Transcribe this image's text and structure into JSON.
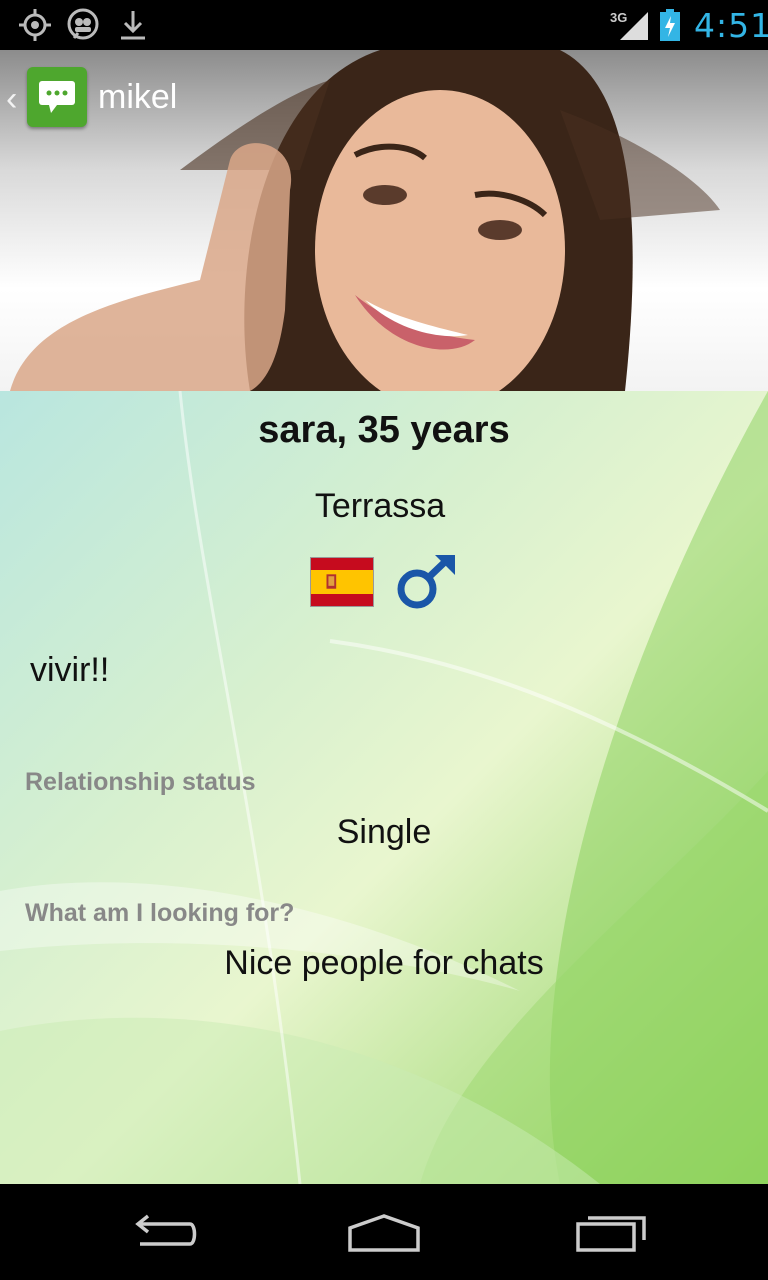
{
  "status_bar": {
    "network": "3G",
    "time": "4:51",
    "icons": [
      "gps-icon",
      "chat-bubbles-icon",
      "download-icon",
      "signal-icon",
      "battery-charging-icon"
    ]
  },
  "action_bar": {
    "title": "mikel",
    "icon": "chat-app-icon"
  },
  "profile": {
    "name_age": "sara, 35 years",
    "city": "Terrassa",
    "country_flag": "spain-flag-icon",
    "gender_icon": "male-symbol-icon",
    "about": "vivir!!",
    "relationship_label": "Relationship status",
    "relationship_value": "Single",
    "looking_label": "What am I looking for?",
    "looking_value": "Nice people for chats"
  },
  "nav_bar": {
    "buttons": [
      "back-icon",
      "home-icon",
      "recent-apps-icon"
    ]
  },
  "colors": {
    "accent": "#33b5e5",
    "app_icon": "#4ea72e",
    "label_gray": "#888888"
  }
}
